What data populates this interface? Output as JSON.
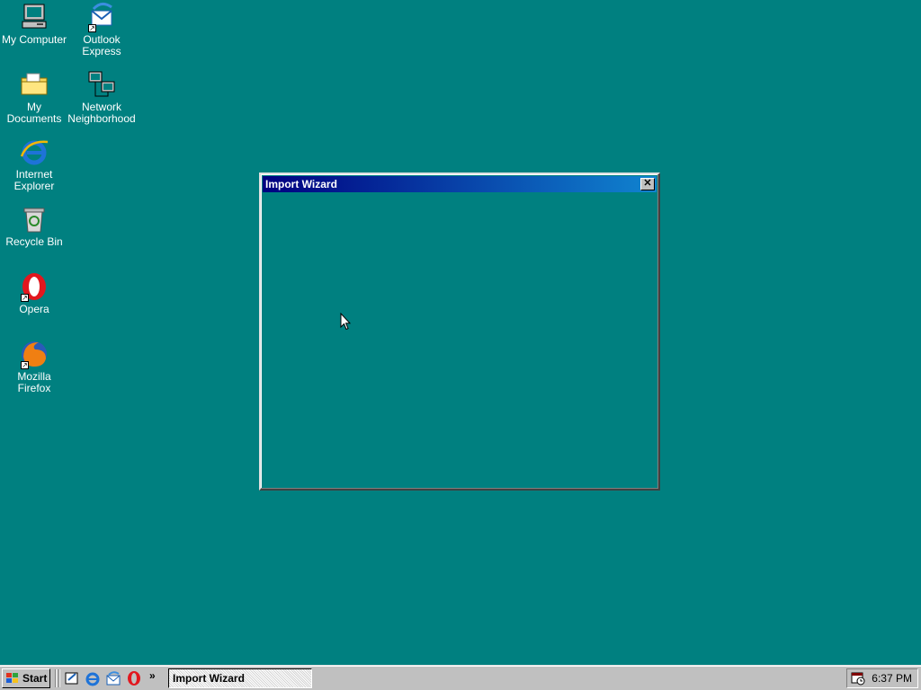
{
  "desktop": {
    "background": "#008080",
    "icons": [
      {
        "label": "My Computer",
        "icon": "computer-icon"
      },
      {
        "label": "Outlook Express",
        "icon": "outlook-express-icon"
      },
      {
        "label": "My Documents",
        "icon": "folder-icon"
      },
      {
        "label": "Network Neighborhood",
        "icon": "network-icon"
      },
      {
        "label": "Internet Explorer",
        "icon": "internet-explorer-icon"
      },
      {
        "label": "Recycle Bin",
        "icon": "recycle-bin-icon"
      },
      {
        "label": "Opera",
        "icon": "opera-icon"
      },
      {
        "label": "Mozilla Firefox",
        "icon": "firefox-icon"
      }
    ]
  },
  "window": {
    "title": "Import Wizard",
    "close_icon": "close-icon",
    "title_gradient": [
      "#000080",
      "#1084d0"
    ]
  },
  "taskbar": {
    "start_label": "Start",
    "quick_launch": [
      "show-desktop-icon",
      "internet-explorer-icon",
      "outlook-express-icon",
      "opera-icon"
    ],
    "more_label": "»",
    "task_button_label": "Import Wizard",
    "clock": "6:37 PM"
  }
}
